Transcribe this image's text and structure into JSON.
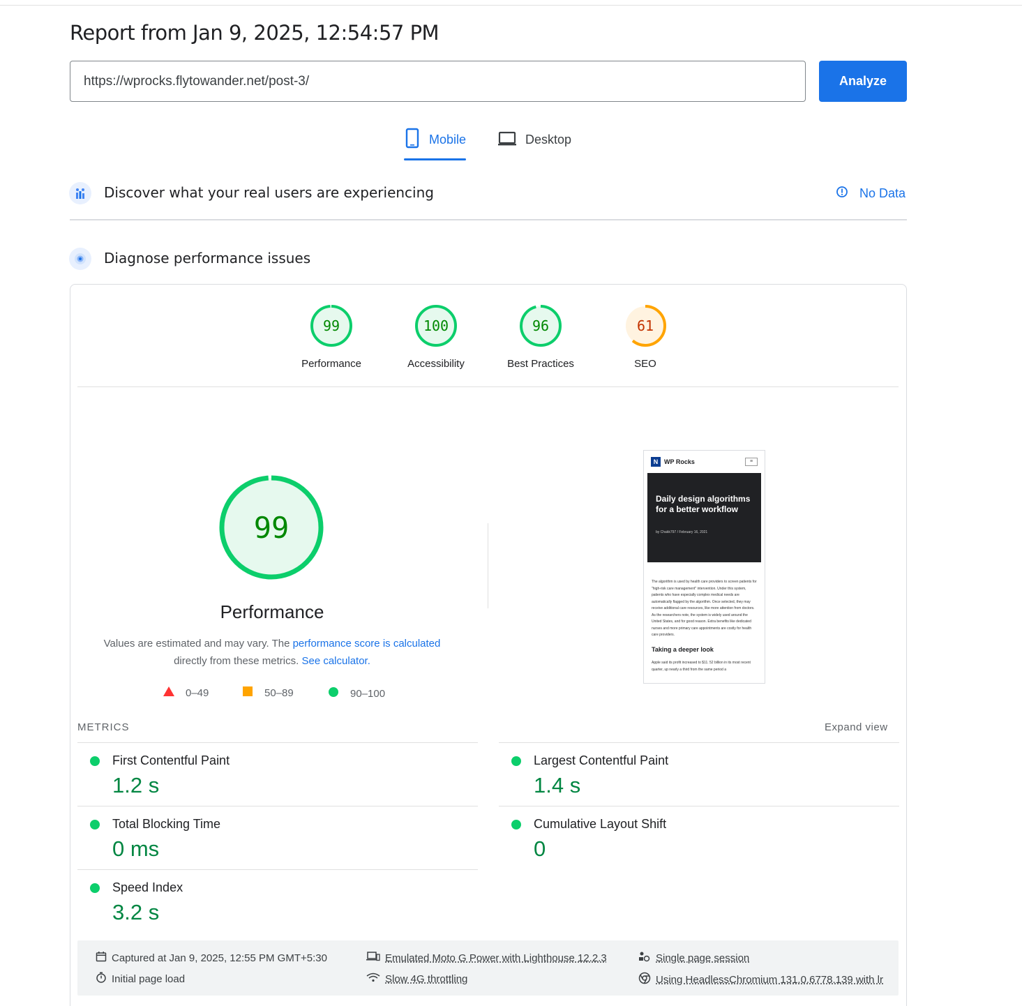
{
  "header": {
    "title": "Report from Jan 9, 2025, 12:54:57 PM",
    "url": "https://wprocks.flytowander.net/post-3/",
    "analyze_label": "Analyze"
  },
  "tabs": [
    {
      "label": "Mobile",
      "active": true
    },
    {
      "label": "Desktop",
      "active": false
    }
  ],
  "crux": {
    "title": "Discover what your real users are experiencing",
    "status": "No Data"
  },
  "diagnose": {
    "title": "Diagnose performance issues"
  },
  "categories": [
    {
      "label": "Performance",
      "score": "99",
      "value": 99,
      "color": "#0cce6b",
      "text_color": "#008800",
      "fill": "#e6f9ee"
    },
    {
      "label": "Accessibility",
      "score": "100",
      "value": 100,
      "color": "#0cce6b",
      "text_color": "#008800",
      "fill": "#e6f9ee"
    },
    {
      "label": "Best Practices",
      "score": "96",
      "value": 96,
      "color": "#0cce6b",
      "text_color": "#008800",
      "fill": "#e6f9ee"
    },
    {
      "label": "SEO",
      "score": "61",
      "value": 61,
      "color": "#ffa400",
      "text_color": "#c33300",
      "fill": "#fff3e0"
    }
  ],
  "performance": {
    "score": "99",
    "value": 99,
    "title": "Performance",
    "desc_prefix": "Values are estimated and may vary. The ",
    "desc_link1": "performance score is calculated",
    "desc_mid": "directly from these metrics. ",
    "desc_link2": "See calculator.",
    "legend": [
      "0–49",
      "50–89",
      "90–100"
    ]
  },
  "screenshot": {
    "site": "WP Rocks",
    "logo_letter": "N",
    "headline": "Daily design algorithms for a better workflow",
    "meta": "by Chakk797  /  February 16, 2021",
    "paragraph": "The algorithm is used by health care providers to screen patients for \"high-risk care management\" intervention. Under this system, patients who have especially complex medical needs are automatically flagged by the algorithm. Once selected, they may receive additional care resources, like more attention from doctors. As the researchers note, the system is widely used around the United States, and for good reason. Extra benefits like dedicated nurses and more primary care appointments are costly for health care providers.",
    "subheading": "Taking a deeper look",
    "paragraph2": "Apple said its profit increased to $11. 52 billion in its most recent quarter, up nearly a third from the same period a"
  },
  "metrics": {
    "label": "METRICS",
    "expand": "Expand view",
    "items": [
      {
        "name": "First Contentful Paint",
        "value": "1.2 s"
      },
      {
        "name": "Largest Contentful Paint",
        "value": "1.4 s"
      },
      {
        "name": "Total Blocking Time",
        "value": "0 ms"
      },
      {
        "name": "Cumulative Layout Shift",
        "value": "0"
      },
      {
        "name": "Speed Index",
        "value": "3.2 s"
      }
    ]
  },
  "footer": {
    "captured": "Captured at Jan 9, 2025, 12:55 PM GMT+5:30",
    "initial_load": "Initial page load",
    "device": "Emulated Moto G Power with Lighthouse 12.2.3",
    "throttling": "Slow 4G throttling",
    "session": "Single page session",
    "browser": "Using HeadlessChromium 131.0.6778.139 with lr"
  }
}
